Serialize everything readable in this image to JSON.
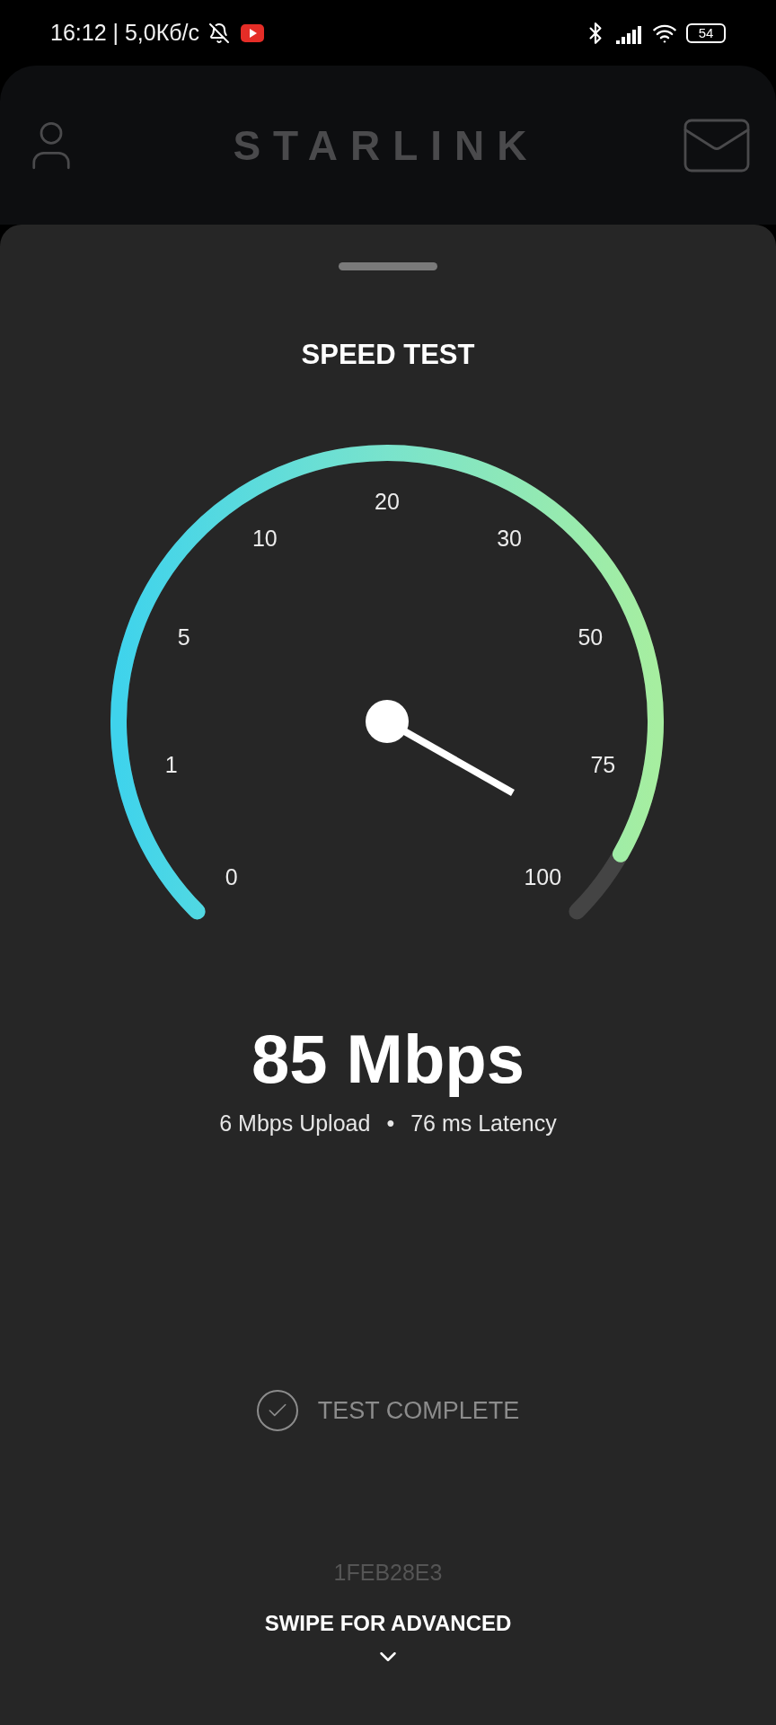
{
  "status_bar": {
    "time_and_speed": "16:12 | 5,0Кб/с",
    "battery": "54"
  },
  "header": {
    "logo": "STARLINK"
  },
  "sheet": {
    "title": "SPEED TEST",
    "gauge": {
      "scale": [
        "0",
        "1",
        "5",
        "10",
        "20",
        "30",
        "50",
        "75",
        "100"
      ]
    },
    "download": "85 Mbps",
    "upload": "6 Mbps Upload",
    "separator": "•",
    "latency": "76 ms Latency",
    "status": "TEST COMPLETE",
    "id": "1FEB28E3",
    "hint": "SWIPE FOR ADVANCED"
  }
}
